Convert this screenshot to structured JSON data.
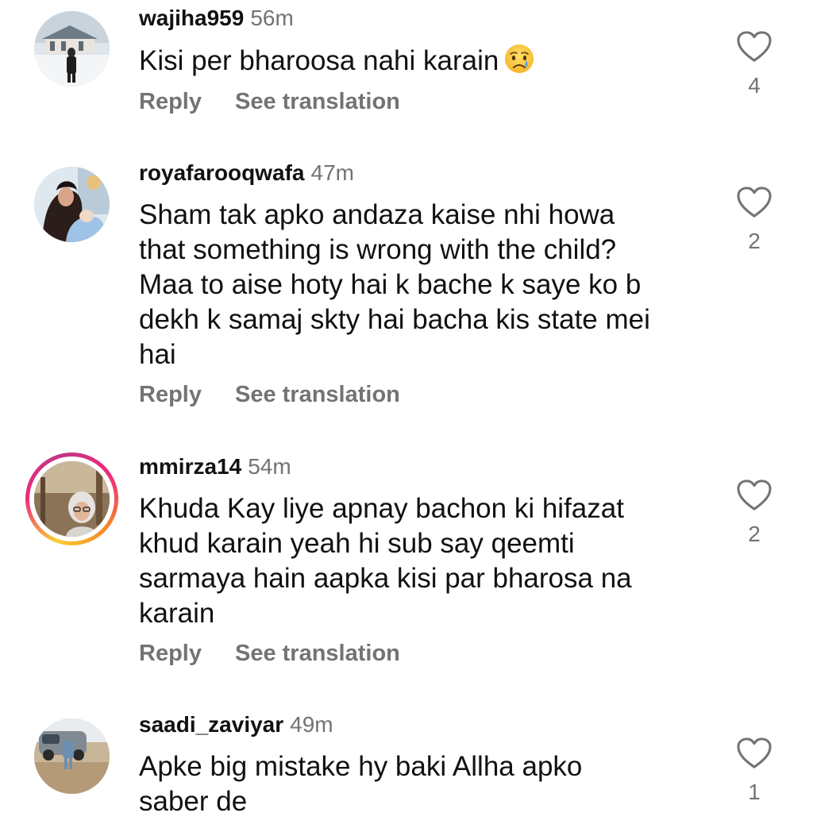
{
  "comments": [
    {
      "username": "wajiha959",
      "time": "56m",
      "lines": [
        "Kisi per bharoosa nahi karain"
      ],
      "emoji": "crying-face",
      "reply_label": "Reply",
      "translate_label": "See translation",
      "likes": "4"
    },
    {
      "username": "royafarooqwafa",
      "time": "47m",
      "lines": [
        "Sham tak apko andaza kaise nhi howa",
        "that something is wrong with the child?",
        "Maa to aise hoty hai k bache k saye ko b",
        "dekh k samaj skty hai bacha kis state mei",
        "hai"
      ],
      "reply_label": "Reply",
      "translate_label": "See translation",
      "likes": "2"
    },
    {
      "username": "mmirza14",
      "time": "54m",
      "lines": [
        "Khuda Kay liye apnay bachon ki hifazat",
        "khud karain yeah hi sub say qeemti",
        "sarmaya hain aapka kisi par bharosa na",
        "karain"
      ],
      "reply_label": "Reply",
      "translate_label": "See translation",
      "likes": "2"
    },
    {
      "username": "saadi_zaviyar",
      "time": "49m",
      "lines": [
        "Apke big mistake hy baki Allha apko",
        "saber de"
      ],
      "likes": "1"
    }
  ],
  "icons": {
    "like": "heart-outline-icon"
  },
  "colors": {
    "text": "#111111",
    "secondary": "#737373",
    "story_ring": [
      "#f9ce34",
      "#ee2a7b",
      "#c13584"
    ]
  }
}
